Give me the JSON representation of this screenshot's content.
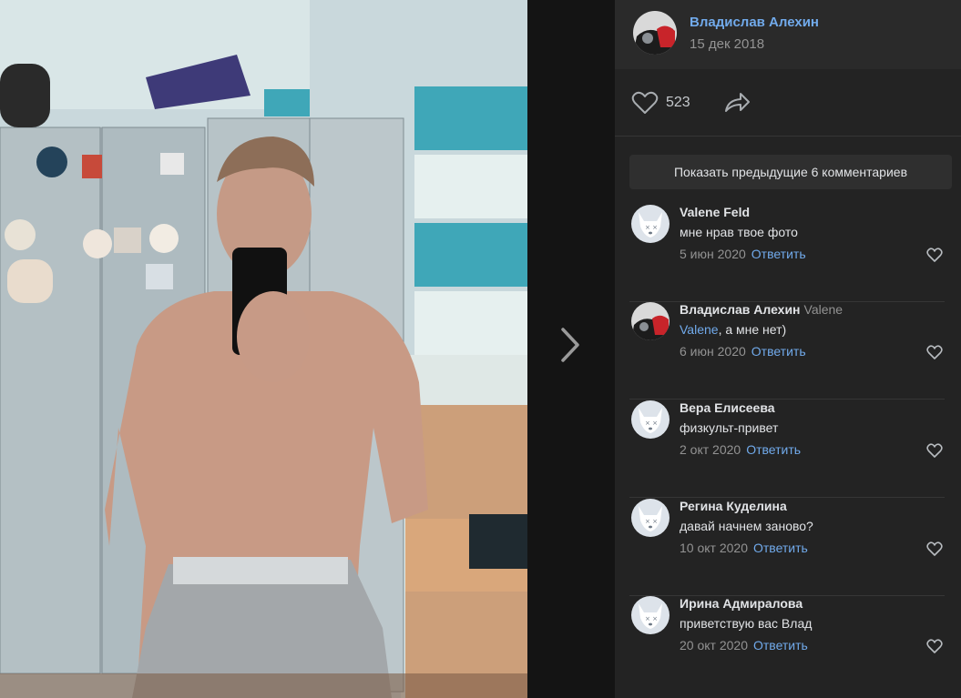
{
  "post": {
    "author": "Владислав Алехин",
    "date": "15 дек 2018",
    "likes": "523"
  },
  "comments_section": {
    "show_previous_label": "Показать предыдущие 6 комментариев",
    "reply_label": "Ответить",
    "items": [
      {
        "author": "Valene Feld",
        "reply_to": "",
        "mention": "",
        "text": "мне нрав твое фото",
        "date": "5 июн 2020",
        "avatar": "default-avatar"
      },
      {
        "author": "Владислав Алехин",
        "reply_to": "Valene",
        "mention": "Valene",
        "text": ", а мне нет)",
        "date": "6 июн 2020",
        "avatar": "author-photo-avatar"
      },
      {
        "author": "Вера Елисеева",
        "reply_to": "",
        "mention": "",
        "text": "физкульт-привет",
        "date": "2 окт 2020",
        "avatar": "default-avatar"
      },
      {
        "author": "Регина Куделина",
        "reply_to": "",
        "mention": "",
        "text": "давай начнем заново?",
        "date": "10 окт 2020",
        "avatar": "default-avatar"
      },
      {
        "author": "Ирина Адмиралова",
        "reply_to": "",
        "mention": "",
        "text": "приветствую вас Влад",
        "date": "20 окт 2020",
        "avatar": "default-avatar"
      }
    ]
  },
  "icons": {
    "like": "heart-icon",
    "share": "share-arrow-icon",
    "next": "chevron-right-icon"
  },
  "colors": {
    "accent_link": "#71aaeb",
    "background": "#141414",
    "sidebar": "#232323"
  }
}
